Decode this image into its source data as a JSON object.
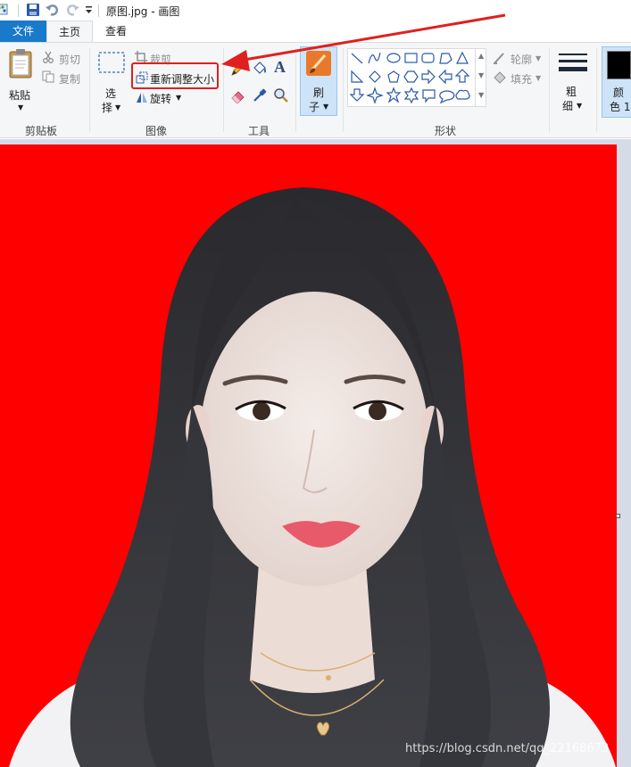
{
  "window": {
    "title": "原图.jpg - 画图"
  },
  "quick_access": {
    "icons": [
      "paint-app-icon",
      "save-icon",
      "undo-icon",
      "redo-icon",
      "customize-dropdown-icon"
    ]
  },
  "tabs": {
    "file": "文件",
    "home": "主页",
    "view": "查看",
    "file_color": "#1979ca"
  },
  "ribbon": {
    "clipboard": {
      "paste": "粘贴",
      "cut": "剪切",
      "copy": "复制",
      "label": "剪贴板"
    },
    "image": {
      "select_line1": "选",
      "select_line2": "择",
      "crop": "裁剪",
      "resize": "重新调整大小",
      "rotate": "旋转",
      "label": "图像"
    },
    "tools": {
      "label": "工具",
      "text_tool": "A"
    },
    "brushes": {
      "line1": "刷",
      "line2": "子"
    },
    "shapes": {
      "outline": "轮廓",
      "fill": "填充",
      "label": "形状"
    },
    "size": {
      "line1": "粗",
      "line2": "细"
    },
    "color1": {
      "line1": "颜",
      "line2": "色 1",
      "value": "#000000"
    },
    "highlight_color": "#e0201e"
  },
  "canvas": {
    "background_color": "#ff0000",
    "workspace_color": "#d5dce8"
  },
  "watermark": "https://blog.csdn.net/qq_22168673"
}
